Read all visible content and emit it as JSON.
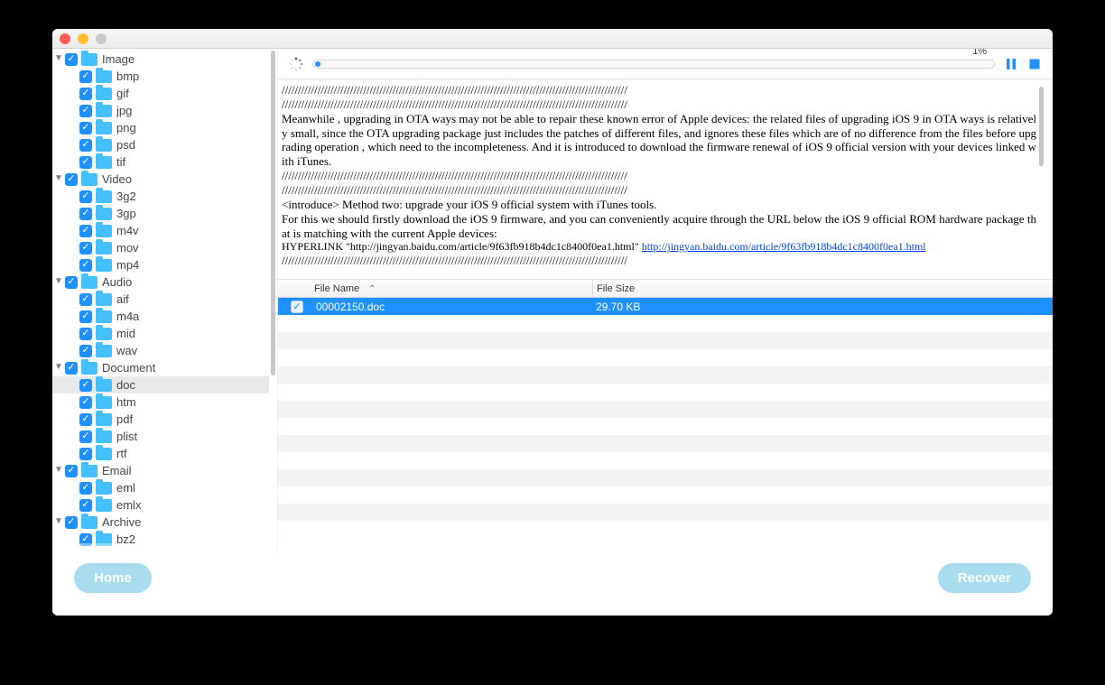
{
  "progress": {
    "percent_label": "1%"
  },
  "sidebar": {
    "groups": [
      {
        "label": "Image",
        "children": [
          "bmp",
          "gif",
          "jpg",
          "png",
          "psd",
          "tif"
        ]
      },
      {
        "label": "Video",
        "children": [
          "3g2",
          "3gp",
          "m4v",
          "mov",
          "mp4"
        ]
      },
      {
        "label": "Audio",
        "children": [
          "aif",
          "m4a",
          "mid",
          "wav"
        ]
      },
      {
        "label": "Document",
        "children": [
          "doc",
          "htm",
          "pdf",
          "plist",
          "rtf"
        ],
        "selected_child": "doc"
      },
      {
        "label": "Email",
        "children": [
          "eml",
          "emlx"
        ]
      },
      {
        "label": "Archive",
        "children": [
          "bz2"
        ]
      }
    ]
  },
  "preview": {
    "slashes": "//////////////////////////////////////////////////////////////////////////////////////////////////////////",
    "para1": "Meanwhile , upgrading in OTA ways may not be able to repair these known error of Apple devices: the related files of upgrading iOS 9 in OTA ways is relatively small, since the OTA upgrading package just includes the patches of different files, and ignores these files which are of no difference from the files before upgrading operation , which need to the incompleteness. And it is introduced to download the firmware renewal of iOS 9 official version with your devices linked with iTunes.",
    "para2": "<introduce> Method two: upgrade your iOS 9 official system with iTunes tools.",
    "para3": "For this we should firstly download the iOS 9 firmware, and you can conveniently acquire through the URL below the iOS 9 official ROM hardware package that is matching with the current Apple devices:",
    "link_prefix": " HYPERLINK \"http://jingyan.baidu.com/article/9f63fb918b4dc1c8400f0ea1.html\" ",
    "link_text": "http://jingyan.baidu.com/article/9f63fb918b4dc1c8400f0ea1.html"
  },
  "columns": {
    "name": "File Name",
    "size": "File Size"
  },
  "files": [
    {
      "name": "00002150.doc",
      "size": "29.70 KB",
      "selected": true
    }
  ],
  "footer": {
    "home": "Home",
    "recover": "Recover"
  }
}
